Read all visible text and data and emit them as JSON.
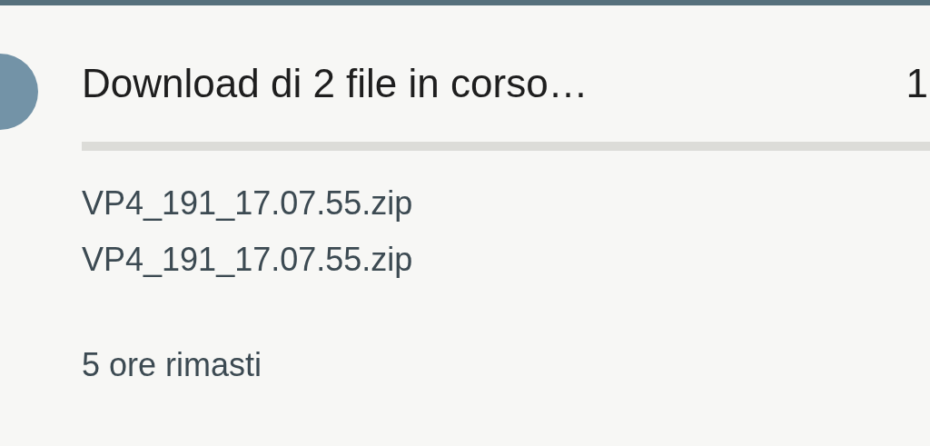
{
  "notification": {
    "title": "Download di 2 file in corso…",
    "time": "1",
    "progress": {
      "level": 0
    },
    "files": [
      "VP4_191_17.07.55.zip",
      "VP4_191_17.07.55.zip"
    ],
    "remaining": "5 ore rimasti"
  }
}
